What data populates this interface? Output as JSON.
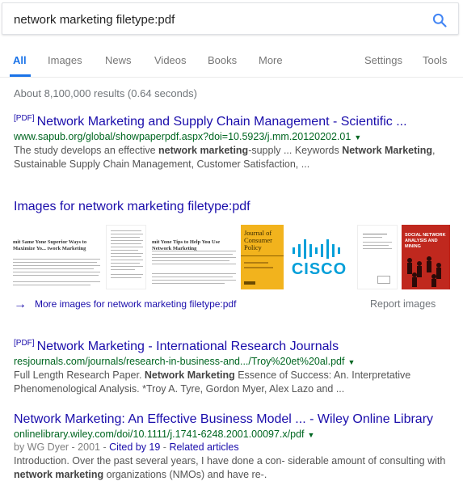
{
  "search": {
    "query": "network marketing filetype:pdf"
  },
  "tabs": [
    {
      "label": "All"
    },
    {
      "label": "Images"
    },
    {
      "label": "News"
    },
    {
      "label": "Videos"
    },
    {
      "label": "Books"
    },
    {
      "label": "More"
    },
    {
      "label": "Settings"
    },
    {
      "label": "Tools"
    }
  ],
  "stats": "About 8,100,000 results (0.64 seconds)",
  "results": [
    {
      "tag": "[PDF]",
      "title": "Network Marketing and Supply Chain Management - Scientific ...",
      "url": "www.sapub.org/global/showpaperpdf.aspx?doi=10.5923/j.mm.20120202.01",
      "snippet_a": "The study develops an effective ",
      "snippet_b": "network marketing",
      "snippet_c": "-supply ... Keywords ",
      "snippet_d": "Network Marketing",
      "snippet_e": ", Sustainable Supply Chain Management, Customer Satisfaction, ..."
    },
    {
      "tag": "[PDF]",
      "title": "Network Marketing - International Research Journals",
      "url": "resjournals.com/journals/research-in-business-and.../Troy%20et%20al.pdf",
      "snippet_a": "Full Length Research Paper. ",
      "snippet_b": "Network Marketing",
      "snippet_c": " Essence of Success: An. Interpretative Phenomenological Analysis. *Troy A. Tyre, Gordon Myer, Alex Lazo and ..."
    },
    {
      "title": "Network Marketing: An Effective Business Model ... - Wiley Online Library",
      "url": "onlinelibrary.wiley.com/doi/10.1111/j.1741-6248.2001.00097.x/pdf",
      "meta_by": "by WG Dyer - 2001 - ",
      "meta_cited": "Cited by 19",
      "meta_sep": " - ",
      "meta_related": "Related articles",
      "snippet_a": "Introduction. Over the past several years, I have done a con- siderable amount of consulting with ",
      "snippet_b": "network marketing",
      "snippet_c": " organizations (NMOs) and have re-."
    }
  ],
  "images": {
    "heading": "Images for network marketing filetype:pdf",
    "more_label": "More images for network marketing filetype:pdf",
    "report_label": "Report images",
    "thumb1_heading": "mit Same Yone Superior Ways to Maximize Yo... twork Marketing",
    "thumb3_heading": "mit Yone Tips to Help You Use Network Marketing",
    "journal_title": "Journal of Consumer Policy",
    "cisco_text": "CISCO",
    "sna_title": "SOCIAL NETWORK ANALYSIS AND MINING"
  },
  "colors": {
    "link": "#1a0dab",
    "url_green": "#006621",
    "accent_blue": "#1a73e8",
    "journal_yellow": "#f2b31d",
    "cisco_blue": "#049fd9",
    "sna_red": "#c0281e"
  }
}
